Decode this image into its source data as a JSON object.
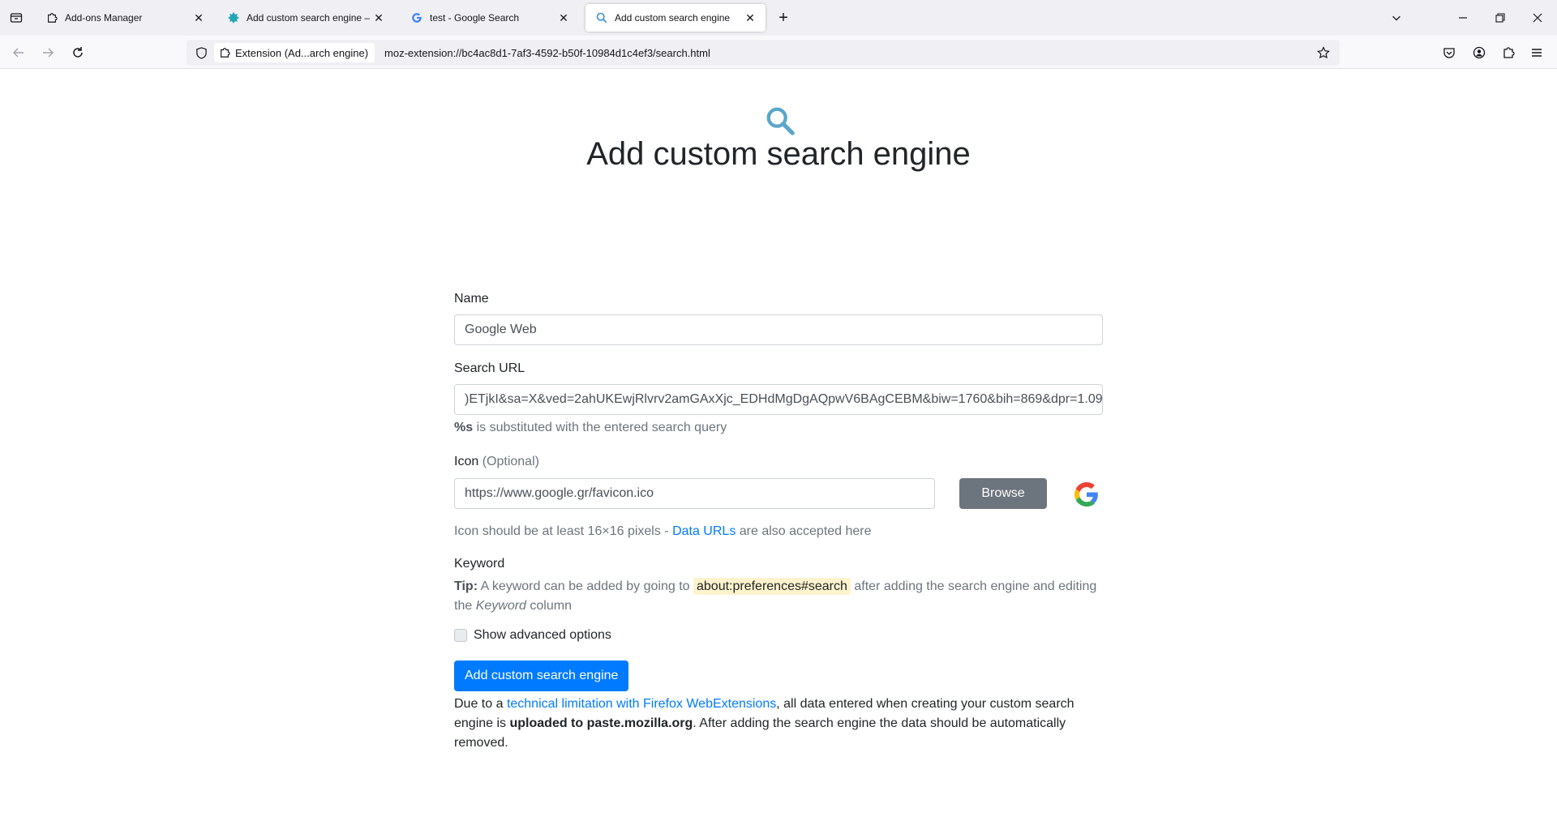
{
  "tabs": [
    {
      "title": "Add-ons Manager",
      "icon": "puzzle-icon",
      "active": false
    },
    {
      "title": "Add custom search engine – Ge",
      "icon": "extension-logo-icon",
      "active": false
    },
    {
      "title": "test - Google Search",
      "icon": "google-g-icon",
      "active": false
    },
    {
      "title": "Add custom search engine",
      "icon": "search-icon",
      "active": true
    }
  ],
  "navbar": {
    "identity_label": "Extension (Ad...arch engine)",
    "url": "moz-extension://bc4ac8d1-7af3-4592-b50f-10984d1c4ef3/search.html"
  },
  "page": {
    "title": "Add custom search engine",
    "name_label": "Name",
    "name_value": "Google Web",
    "search_url_label": "Search URL",
    "search_url_value": ")ETjkI&sa=X&ved=2ahUKEwjRlvrv2amGAxXjc_EDHdMgDgAQpwV6BAgCEBM&biw=1760&bih=869&dpr=1.09",
    "search_url_help_bold": "%s",
    "search_url_help_rest": " is substituted with the entered search query",
    "icon_label": "Icon",
    "icon_optional": "(Optional)",
    "icon_value": "https://www.google.gr/favicon.ico",
    "browse_label": "Browse",
    "icon_help_before": "Icon should be at least 16×16 pixels - ",
    "icon_help_link": "Data URLs",
    "icon_help_after": " are also accepted here",
    "keyword_label": "Keyword",
    "tip_bold": "Tip:",
    "tip_text_1": " A keyword can be added by going to ",
    "tip_code": "about:preferences#search",
    "tip_text_2": " after adding the search engine and editing the ",
    "tip_italic": "Keyword",
    "tip_text_3": " column",
    "advanced_label": "Show advanced options",
    "advanced_checked": false,
    "submit_label": "Add custom search engine",
    "notice_1": "Due to a ",
    "notice_link": "technical limitation with Firefox WebExtensions",
    "notice_2": ", all data entered when creating your custom search engine is ",
    "notice_bold": "uploaded to paste.mozilla.org",
    "notice_3": ". After adding the search engine the data should be automatically removed."
  },
  "colors": {
    "primary": "#007bff",
    "secondary": "#6c757d",
    "header_icon": "#5aa6c9"
  }
}
